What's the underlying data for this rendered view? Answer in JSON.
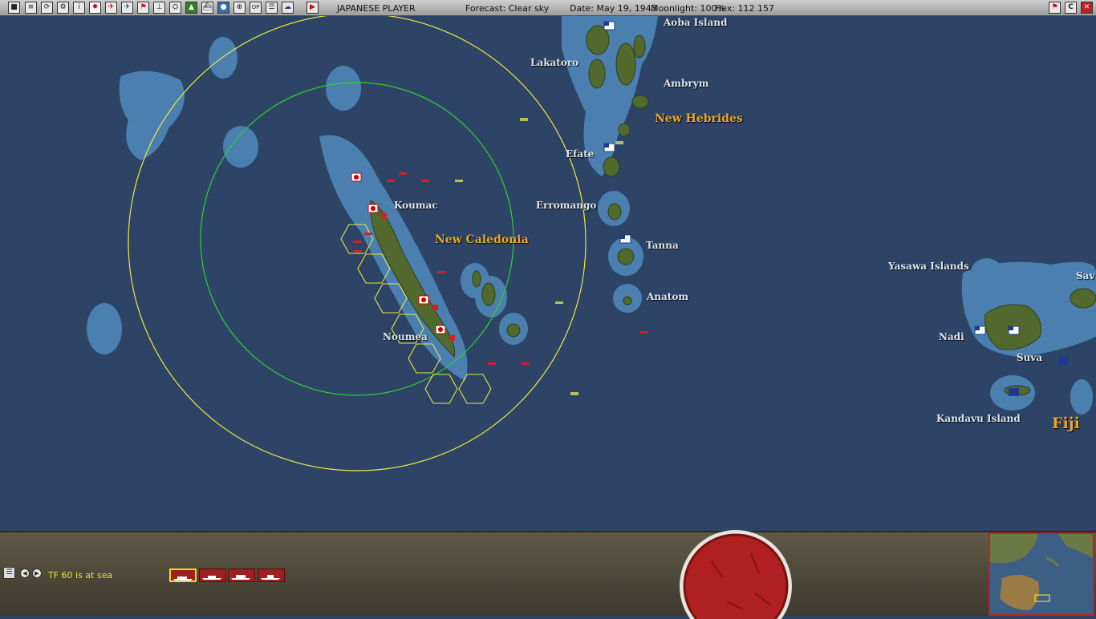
{
  "toolbar": {
    "player": "JAPANESE PLAYER",
    "forecast": "Forecast: Clear sky",
    "date": "Date: May 19, 1943",
    "moonlight": "Moonlight: 100%",
    "hex": "Hex: 112 157",
    "buttons": [
      "task-forces",
      "reports",
      "replay",
      "options",
      "info",
      "japan-flag",
      "aircraft",
      "ground-units",
      "flag",
      "airbase",
      "bases",
      "land",
      "ships",
      "globe",
      "zoom",
      "ops",
      "list",
      "weather"
    ],
    "right_buttons": [
      "bookmark",
      "close-c",
      "exit-x"
    ]
  },
  "map": {
    "places": [
      {
        "id": "aoba",
        "label": "Aoba Island"
      },
      {
        "id": "lakatoro",
        "label": "Lakatoro"
      },
      {
        "id": "ambrym",
        "label": "Ambrym"
      },
      {
        "id": "efate",
        "label": "Efate"
      },
      {
        "id": "koumac",
        "label": "Koumac"
      },
      {
        "id": "erromango",
        "label": "Erromango"
      },
      {
        "id": "tanna",
        "label": "Tanna"
      },
      {
        "id": "yasawa",
        "label": "Yasawa Islands"
      },
      {
        "id": "anatom",
        "label": "Anatom"
      },
      {
        "id": "noumea",
        "label": "Noumea"
      },
      {
        "id": "nadi",
        "label": "Nadi"
      },
      {
        "id": "suva",
        "label": "Suva"
      },
      {
        "id": "kandavu",
        "label": "Kandavu Island"
      },
      {
        "id": "savu",
        "label": "Sav"
      }
    ],
    "regions": [
      {
        "id": "new-hebrides",
        "label": "New Hebrides"
      },
      {
        "id": "new-caledonia",
        "label": "New Caledonia"
      },
      {
        "id": "fiji",
        "label": "Fiji"
      }
    ],
    "colors": {
      "sea": "#2d4466",
      "shallow": "#4a7fb0",
      "land": "#4f6a2e",
      "japan": "#d42020",
      "usa": "#1d3a8a",
      "yellow_range": "#e8e840",
      "green_range": "#2ed02e"
    }
  },
  "bottom": {
    "status": "TF 60 is at sea",
    "ship_buttons": [
      "ship-1",
      "ship-2",
      "ship-3",
      "ship-4"
    ]
  }
}
